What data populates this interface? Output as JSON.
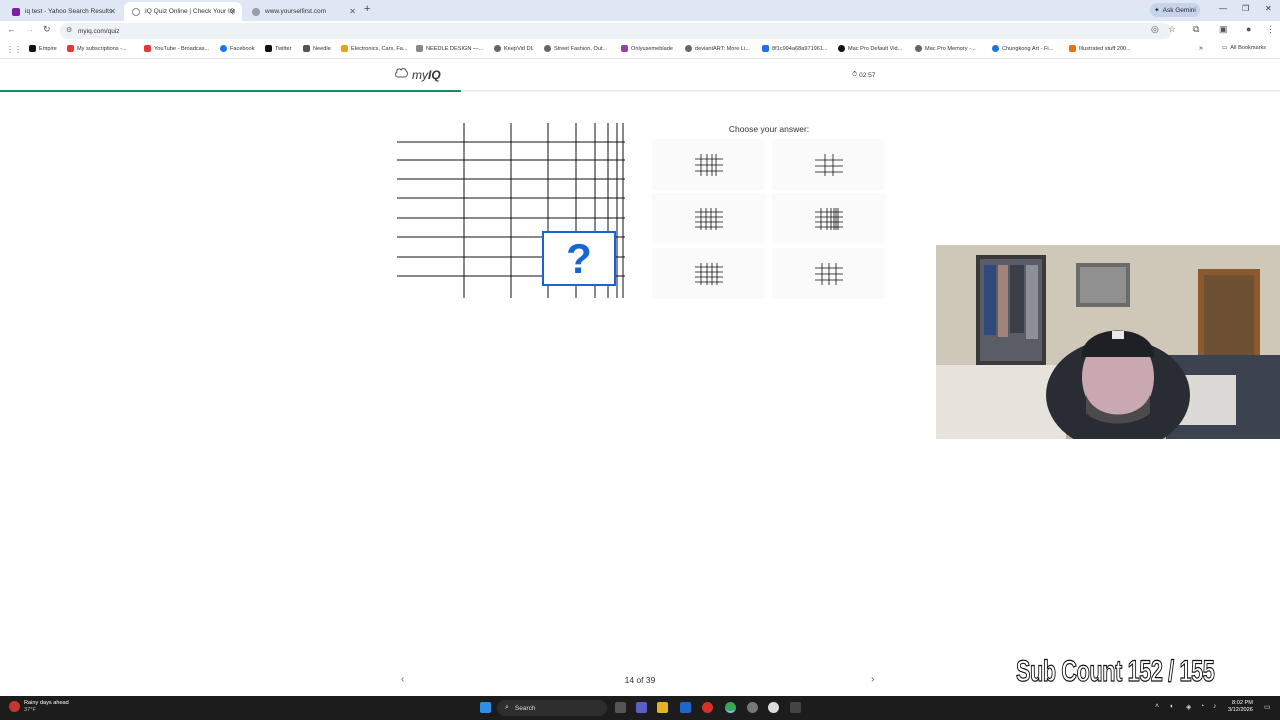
{
  "browser": {
    "tabs": [
      {
        "label": "iq test - Yahoo Search Results",
        "color": "#7b1fa2"
      },
      {
        "label": "IQ Quiz Online | Check Your IQ",
        "color": "#888888"
      },
      {
        "label": "www.yourselfirst.com",
        "color": "#9aa0a6"
      }
    ],
    "ask_gemini": "Ask Gemini",
    "url": "myiq.com/quiz",
    "bookmarks": [
      {
        "label": "Empire",
        "color": "#111111"
      },
      {
        "label": "My subscriptions -...",
        "color": "#e53935"
      },
      {
        "label": "YouTube - Broadcas...",
        "color": "#e53935"
      },
      {
        "label": "Facebook",
        "color": "#1877f2"
      },
      {
        "label": "Twitter",
        "color": "#111111"
      },
      {
        "label": "Needle",
        "color": "#555555"
      },
      {
        "label": "Electronics, Cars, Fa...",
        "color": "#e8a317"
      },
      {
        "label": "NEEDLE DESIGN —...",
        "color": "#888888"
      },
      {
        "label": "KeepVid DL",
        "color": "#666666"
      },
      {
        "label": "Street Fashion, Out...",
        "color": "#666666"
      },
      {
        "label": "Onlyusemeblade",
        "color": "#8e44ad"
      },
      {
        "label": "deviantART: More Li...",
        "color": "#666666"
      },
      {
        "label": "8f1c994a68a971961...",
        "color": "#1a73e8"
      },
      {
        "label": "Mac Pro Default Vid...",
        "color": "#111111"
      },
      {
        "label": "Mac Pro Memory -...",
        "color": "#666666"
      },
      {
        "label": "Chungkong Art - Fi...",
        "color": "#1a73e8"
      },
      {
        "label": "Illustrated stuff 200...",
        "color": "#e8710a"
      }
    ],
    "all_bookmarks": "All Bookmarks"
  },
  "page": {
    "logo_text_my": "my",
    "logo_text_iq": "IQ",
    "timer": "02:57",
    "progress": 0.36,
    "choose_label": "Choose your answer:",
    "question_mark": "?",
    "page_info": "14 of 39",
    "accent_color": "#1f8a62",
    "question_color": "#1565d8"
  },
  "overlay": {
    "sub_count": "Sub Count  152 / 155"
  },
  "taskbar": {
    "weather_title": "Rainy days ahead",
    "weather_temp": "37°F",
    "search_placeholder": "Search",
    "time": "8:02 PM",
    "date": "3/12/2026"
  }
}
